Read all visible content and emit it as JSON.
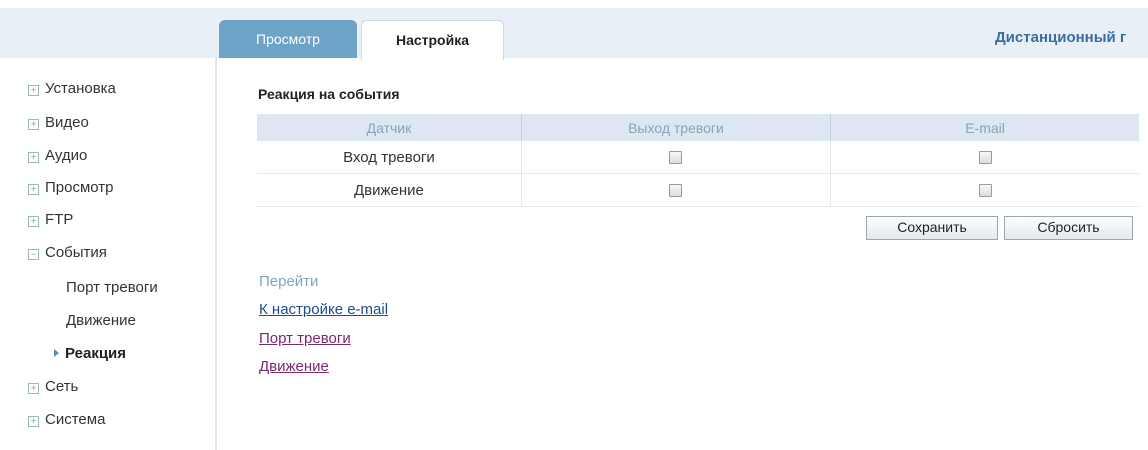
{
  "tabs": {
    "preview": "Просмотр",
    "settings": "Настройка"
  },
  "header": {
    "remote_title": "Дистанционный г"
  },
  "sidebar": {
    "items": [
      "Установка",
      "Видео",
      "Аудио",
      "Просмотр",
      "FTP",
      "События"
    ],
    "events_sub": [
      "Порт тревоги",
      "Движение",
      "Реакция"
    ],
    "items_after": [
      "Сеть",
      "Система"
    ]
  },
  "main": {
    "section_title": "Реакция на события",
    "columns": [
      "Датчик",
      "Выход тревоги",
      "E-mail"
    ],
    "rows": [
      {
        "sensor": "Вход тревоги",
        "alarm_output": false,
        "email": false
      },
      {
        "sensor": "Движение",
        "alarm_output": false,
        "email": false
      }
    ],
    "save_label": "Сохранить",
    "reset_label": "Сбросить",
    "goto_title": "Перейти",
    "links": [
      "К настройке e-mail",
      "Порт тревоги",
      "Движение"
    ]
  },
  "colors": {
    "accent": "#6ea3c8",
    "link_blue": "#1a4f8c",
    "link_visited": "#7a2a6e"
  }
}
